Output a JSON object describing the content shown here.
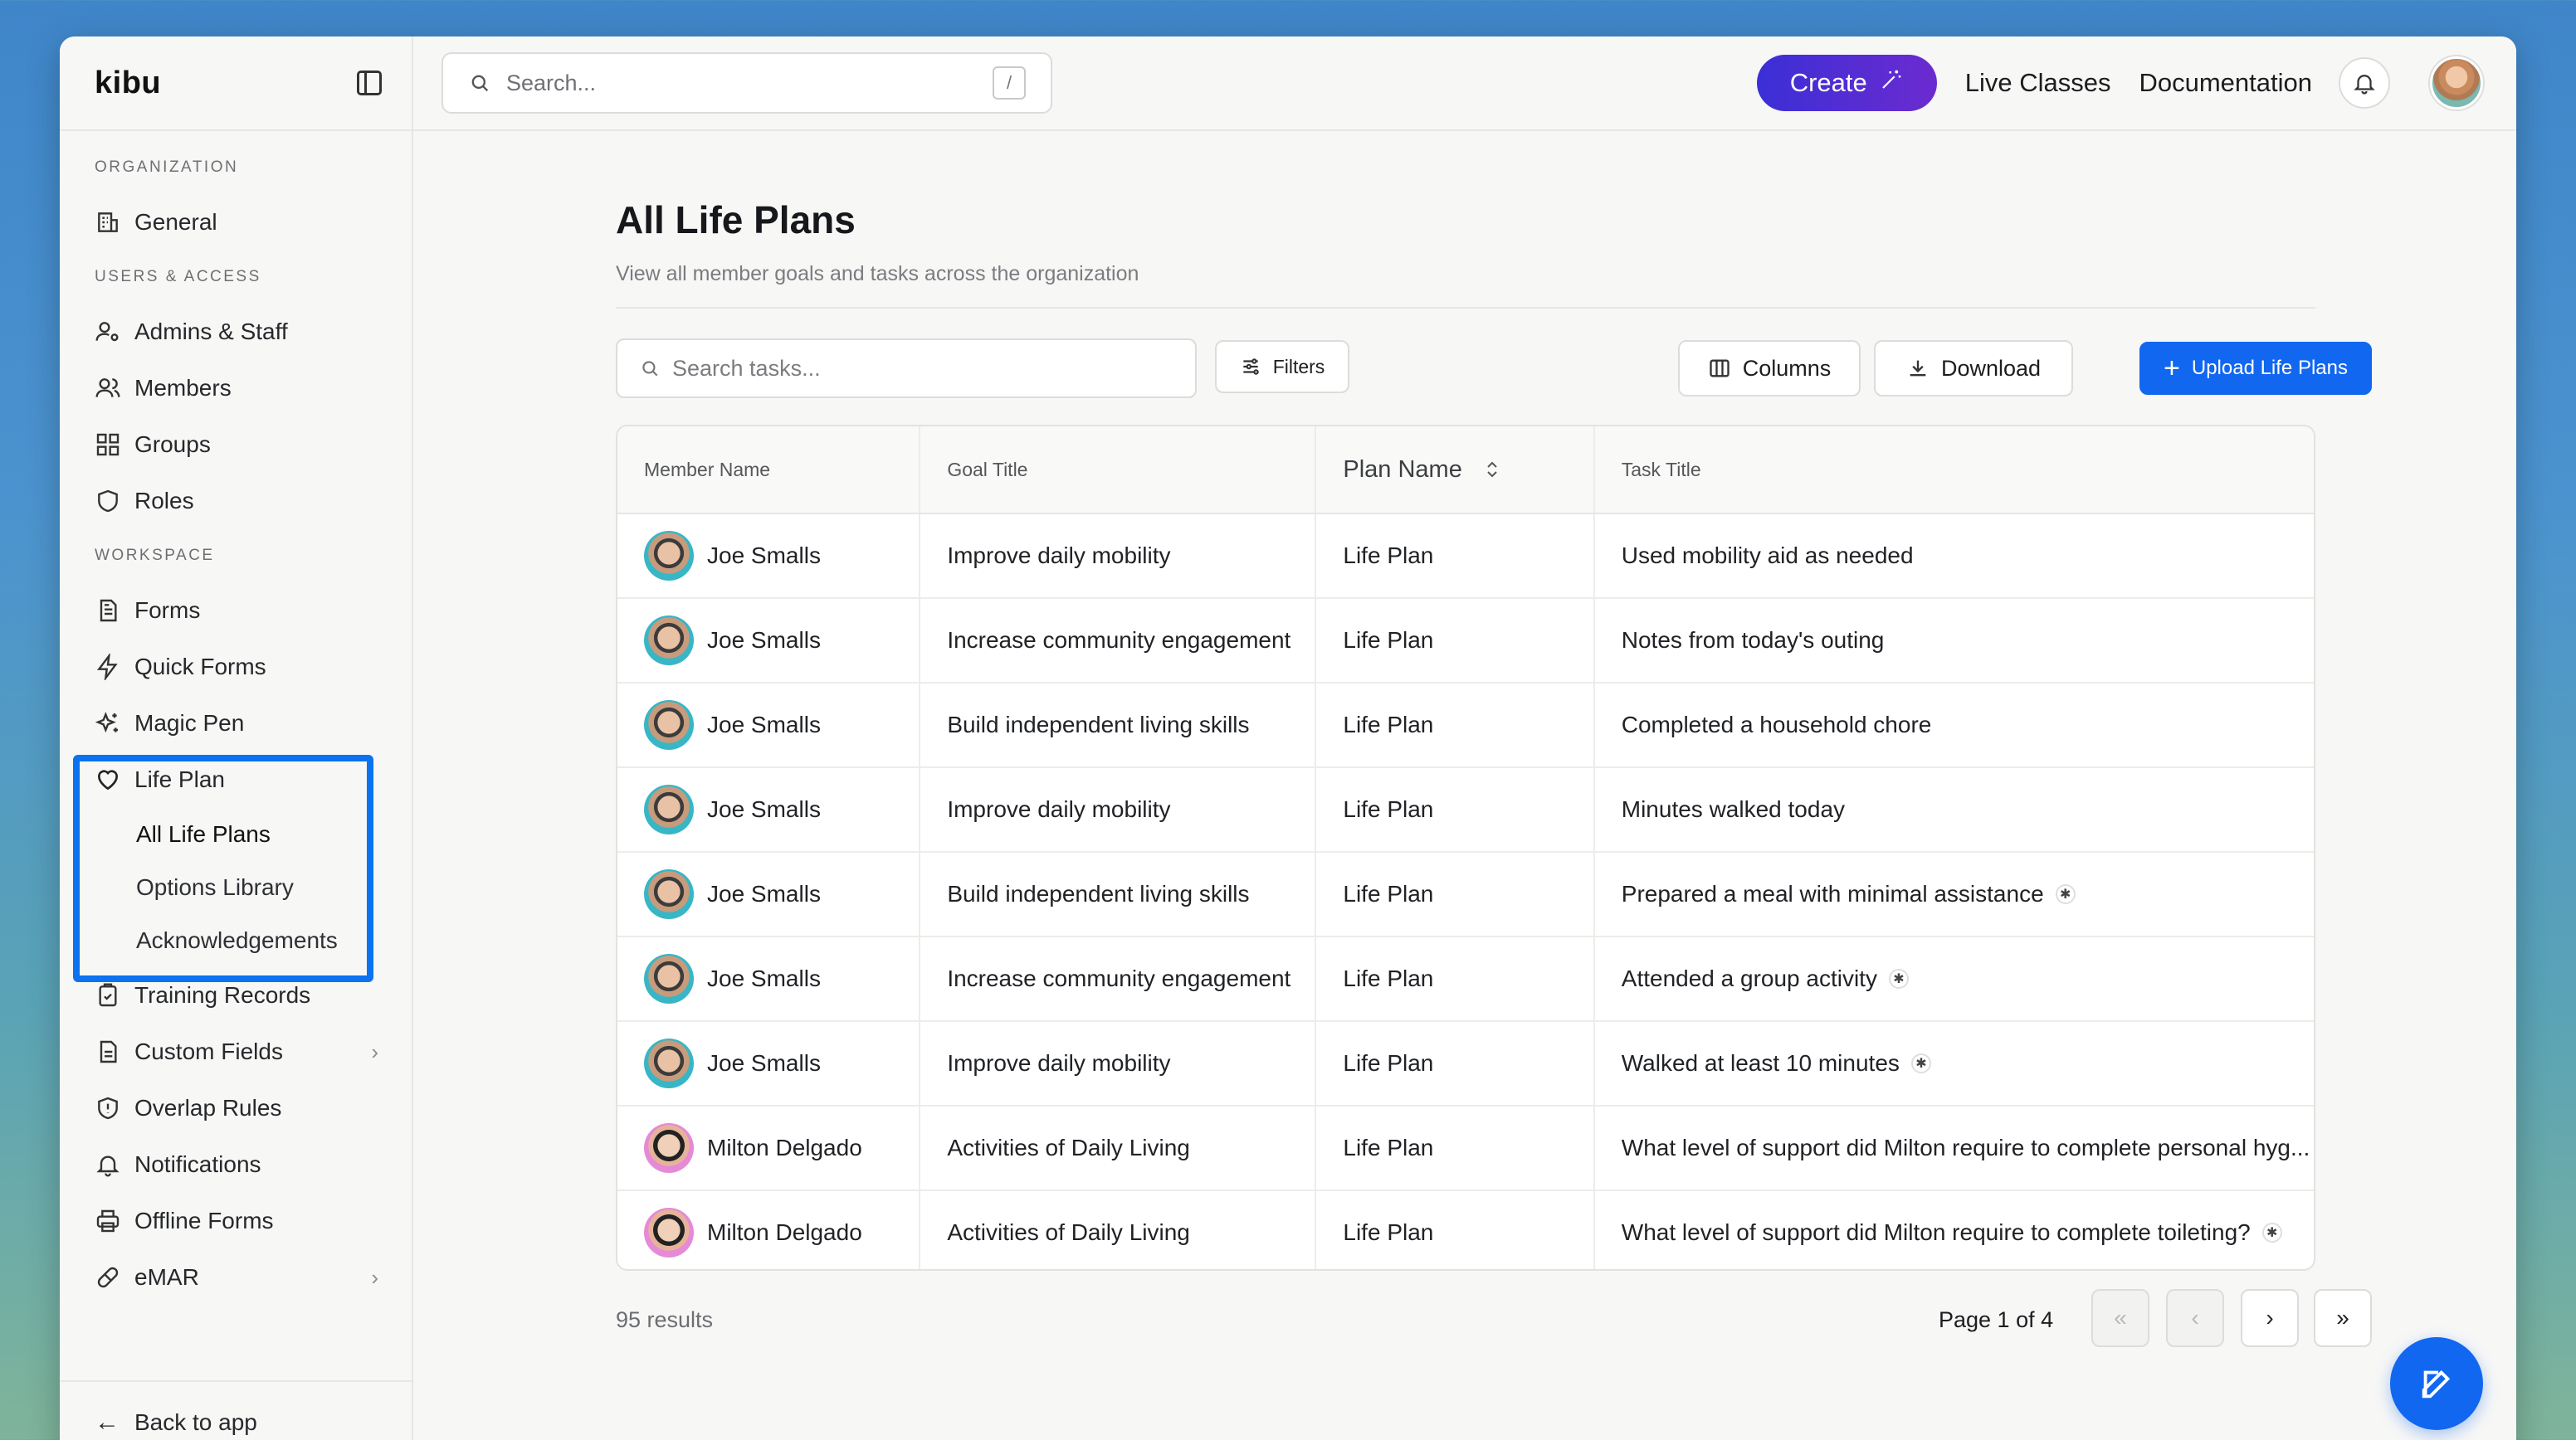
{
  "sidebar": {
    "logo": "kibu",
    "sections": {
      "organization": "ORGANIZATION",
      "users_access": "USERS & ACCESS",
      "workspace": "WORKSPACE"
    },
    "items": {
      "general": "General",
      "admins_staff": "Admins & Staff",
      "members": "Members",
      "groups": "Groups",
      "roles": "Roles",
      "forms": "Forms",
      "quick_forms": "Quick Forms",
      "magic_pen": "Magic Pen",
      "life_plan": "Life Plan",
      "all_life_plans": "All Life Plans",
      "options_library": "Options Library",
      "acknowledgements": "Acknowledgements",
      "training_records": "Training Records",
      "custom_fields": "Custom Fields",
      "overlap_rules": "Overlap Rules",
      "notifications": "Notifications",
      "offline_forms": "Offline Forms",
      "emar": "eMAR"
    },
    "back_to_app": "Back to app",
    "highlight_color": "#0b72f0"
  },
  "topbar": {
    "search_placeholder": "Search...",
    "search_shortcut": "/",
    "create_label": "Create",
    "live_classes": "Live Classes",
    "documentation": "Documentation"
  },
  "page": {
    "title": "All Life Plans",
    "subtitle": "View all member goals and tasks across the organization",
    "task_search_placeholder": "Search tasks...",
    "filters_label": "Filters",
    "columns_label": "Columns",
    "download_label": "Download",
    "upload_label": "Upload Life Plans",
    "accent_color": "#1167f0"
  },
  "table": {
    "headers": {
      "member": "Member Name",
      "goal": "Goal Title",
      "plan": "Plan Name",
      "task": "Task Title"
    },
    "rows": [
      {
        "member": "Joe Smalls",
        "avatar": "joe",
        "goal": "Improve daily mobility",
        "plan": "Life Plan",
        "task": "Used mobility aid as needed",
        "mark": false
      },
      {
        "member": "Joe Smalls",
        "avatar": "joe",
        "goal": "Increase community engagement",
        "plan": "Life Plan",
        "task": "Notes from today's outing",
        "mark": false
      },
      {
        "member": "Joe Smalls",
        "avatar": "joe",
        "goal": "Build independent living skills",
        "plan": "Life Plan",
        "task": "Completed a household chore",
        "mark": false
      },
      {
        "member": "Joe Smalls",
        "avatar": "joe",
        "goal": "Improve daily mobility",
        "plan": "Life Plan",
        "task": "Minutes walked today",
        "mark": false
      },
      {
        "member": "Joe Smalls",
        "avatar": "joe",
        "goal": "Build independent living skills",
        "plan": "Life Plan",
        "task": "Prepared a meal with minimal assistance",
        "mark": true
      },
      {
        "member": "Joe Smalls",
        "avatar": "joe",
        "goal": "Increase community engagement",
        "plan": "Life Plan",
        "task": "Attended a group activity",
        "mark": true
      },
      {
        "member": "Joe Smalls",
        "avatar": "joe",
        "goal": "Improve daily mobility",
        "plan": "Life Plan",
        "task": "Walked at least 10 minutes",
        "mark": true
      },
      {
        "member": "Milton Delgado",
        "avatar": "milton",
        "goal": "Activities of Daily Living",
        "plan": "Life Plan",
        "task": "What level of support did Milton require to complete personal hyg...",
        "mark": false
      },
      {
        "member": "Milton Delgado",
        "avatar": "milton",
        "goal": "Activities of Daily Living",
        "plan": "Life Plan",
        "task": "What level of support did Milton require to complete toileting?",
        "mark": true
      }
    ],
    "mark_glyph": "✱"
  },
  "pagination": {
    "results": "95 results",
    "page_info": "Page 1 of 4",
    "first": "«",
    "prev": "‹",
    "next": "›",
    "last": "»"
  }
}
